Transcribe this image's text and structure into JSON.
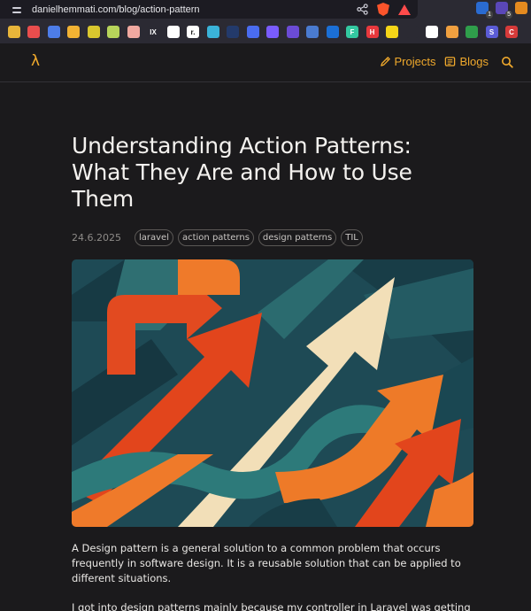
{
  "browser": {
    "url": "danielhemmati.com/blog/action-pattern",
    "extensions": [
      {
        "icon": "bitwarden-icon",
        "badge": "1",
        "color": "#2a6bd1"
      },
      {
        "icon": "notification-icon",
        "badge": "5",
        "color": "#5a47b8"
      },
      {
        "icon": "fox-icon",
        "badge": "",
        "color": "#e58a1f"
      }
    ],
    "bookmarks": [
      {
        "icon": "bookmark-icon-1",
        "color": "#e8b53a",
        "text": ""
      },
      {
        "icon": "bookmark-icon-2",
        "color": "#e94d4d",
        "text": ""
      },
      {
        "icon": "bookmark-icon-3",
        "color": "#4d7de9",
        "text": ""
      },
      {
        "icon": "bookmark-icon-4",
        "color": "#f2b233",
        "text": ""
      },
      {
        "icon": "bookmark-icon-5",
        "color": "#d9c72e",
        "text": ""
      },
      {
        "icon": "bookmark-icon-6",
        "color": "#b7d45a",
        "text": ""
      },
      {
        "icon": "bookmark-icon-7",
        "color": "#f0a8a0",
        "text": ""
      },
      {
        "icon": "bookmark-icon-8",
        "color": "#2b2a33",
        "text": "IX"
      },
      {
        "icon": "bookmark-icon-9",
        "color": "#ffffff",
        "text": ""
      },
      {
        "icon": "bookmark-icon-10",
        "color": "#ffffff",
        "text": "r."
      },
      {
        "icon": "bookmark-icon-11",
        "color": "#3ab3d9",
        "text": ""
      },
      {
        "icon": "bookmark-icon-12",
        "color": "#233a6b",
        "text": ""
      },
      {
        "icon": "bookmark-icon-13",
        "color": "#4a6cf0",
        "text": ""
      },
      {
        "icon": "bookmark-icon-14",
        "color": "#7a5cff",
        "text": ""
      },
      {
        "icon": "bookmark-icon-15",
        "color": "#6b4bd6",
        "text": ""
      },
      {
        "icon": "bookmark-icon-16",
        "color": "#4a7bd0",
        "text": ""
      },
      {
        "icon": "bookmark-icon-17",
        "color": "#1b6fd6",
        "text": ""
      },
      {
        "icon": "bookmark-icon-18",
        "color": "#33c8a0",
        "text": "F"
      },
      {
        "icon": "bookmark-icon-19",
        "color": "#e8383d",
        "text": "H"
      },
      {
        "icon": "bookmark-icon-20",
        "color": "#f5d518",
        "text": ""
      },
      {
        "icon": "bookmark-icon-21",
        "color": "#2b2a33",
        "text": ""
      },
      {
        "icon": "bookmark-icon-22",
        "color": "#ffffff",
        "text": ""
      },
      {
        "icon": "bookmark-icon-23",
        "color": "#f0a040",
        "text": ""
      },
      {
        "icon": "bookmark-icon-24",
        "color": "#2f9e4b",
        "text": ""
      },
      {
        "icon": "bookmark-icon-25",
        "color": "#5b5cd6",
        "text": "S"
      },
      {
        "icon": "bookmark-icon-26",
        "color": "#d63a3a",
        "text": "C"
      }
    ]
  },
  "site": {
    "logo": "λ",
    "nav": {
      "projects_label": "Projects",
      "blogs_label": "Blogs"
    },
    "accent_color": "#f0a92c"
  },
  "article": {
    "title": "Understanding Action Patterns: What They Are and How to Use Them",
    "date": "24.6.2025",
    "tags": [
      "laravel",
      "action patterns",
      "design patterns",
      "TIL"
    ],
    "paragraphs": [
      "A Design pattern is a general solution to a common problem that occurs frequently in software design. It is a reusable solution that can be applied to different situations.",
      "I got into design patterns mainly because my controller in Laravel was getting too"
    ]
  }
}
